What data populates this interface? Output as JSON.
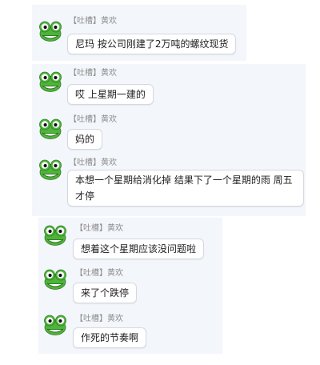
{
  "chat": {
    "messages": [
      {
        "sender": "【吐槽】黄欢",
        "text": "尼玛 按公司刚建了2万吨的螺纹现货"
      },
      {
        "sender": "【吐槽】黄欢",
        "text": "哎 上星期一建的"
      },
      {
        "sender": "【吐槽】黄欢",
        "text": "妈的"
      },
      {
        "sender": "【吐槽】黄欢",
        "text": "本想一个星期给消化掉 结果下了一个星期的雨 周五才停"
      },
      {
        "sender": "【吐槽】黄欢",
        "text": "想着这个星期应该没问题啦"
      },
      {
        "sender": "【吐槽】黄欢",
        "text": "来了个跌停"
      },
      {
        "sender": "【吐槽】黄欢",
        "text": "作死的节奏啊"
      }
    ]
  },
  "colors": {
    "panel_bg": "#f3f6fb",
    "bubble_bg": "#ffffff",
    "bubble_border": "#d4d9e0",
    "name_text": "#8c8c8c",
    "frog_green": "#4fb33c"
  }
}
